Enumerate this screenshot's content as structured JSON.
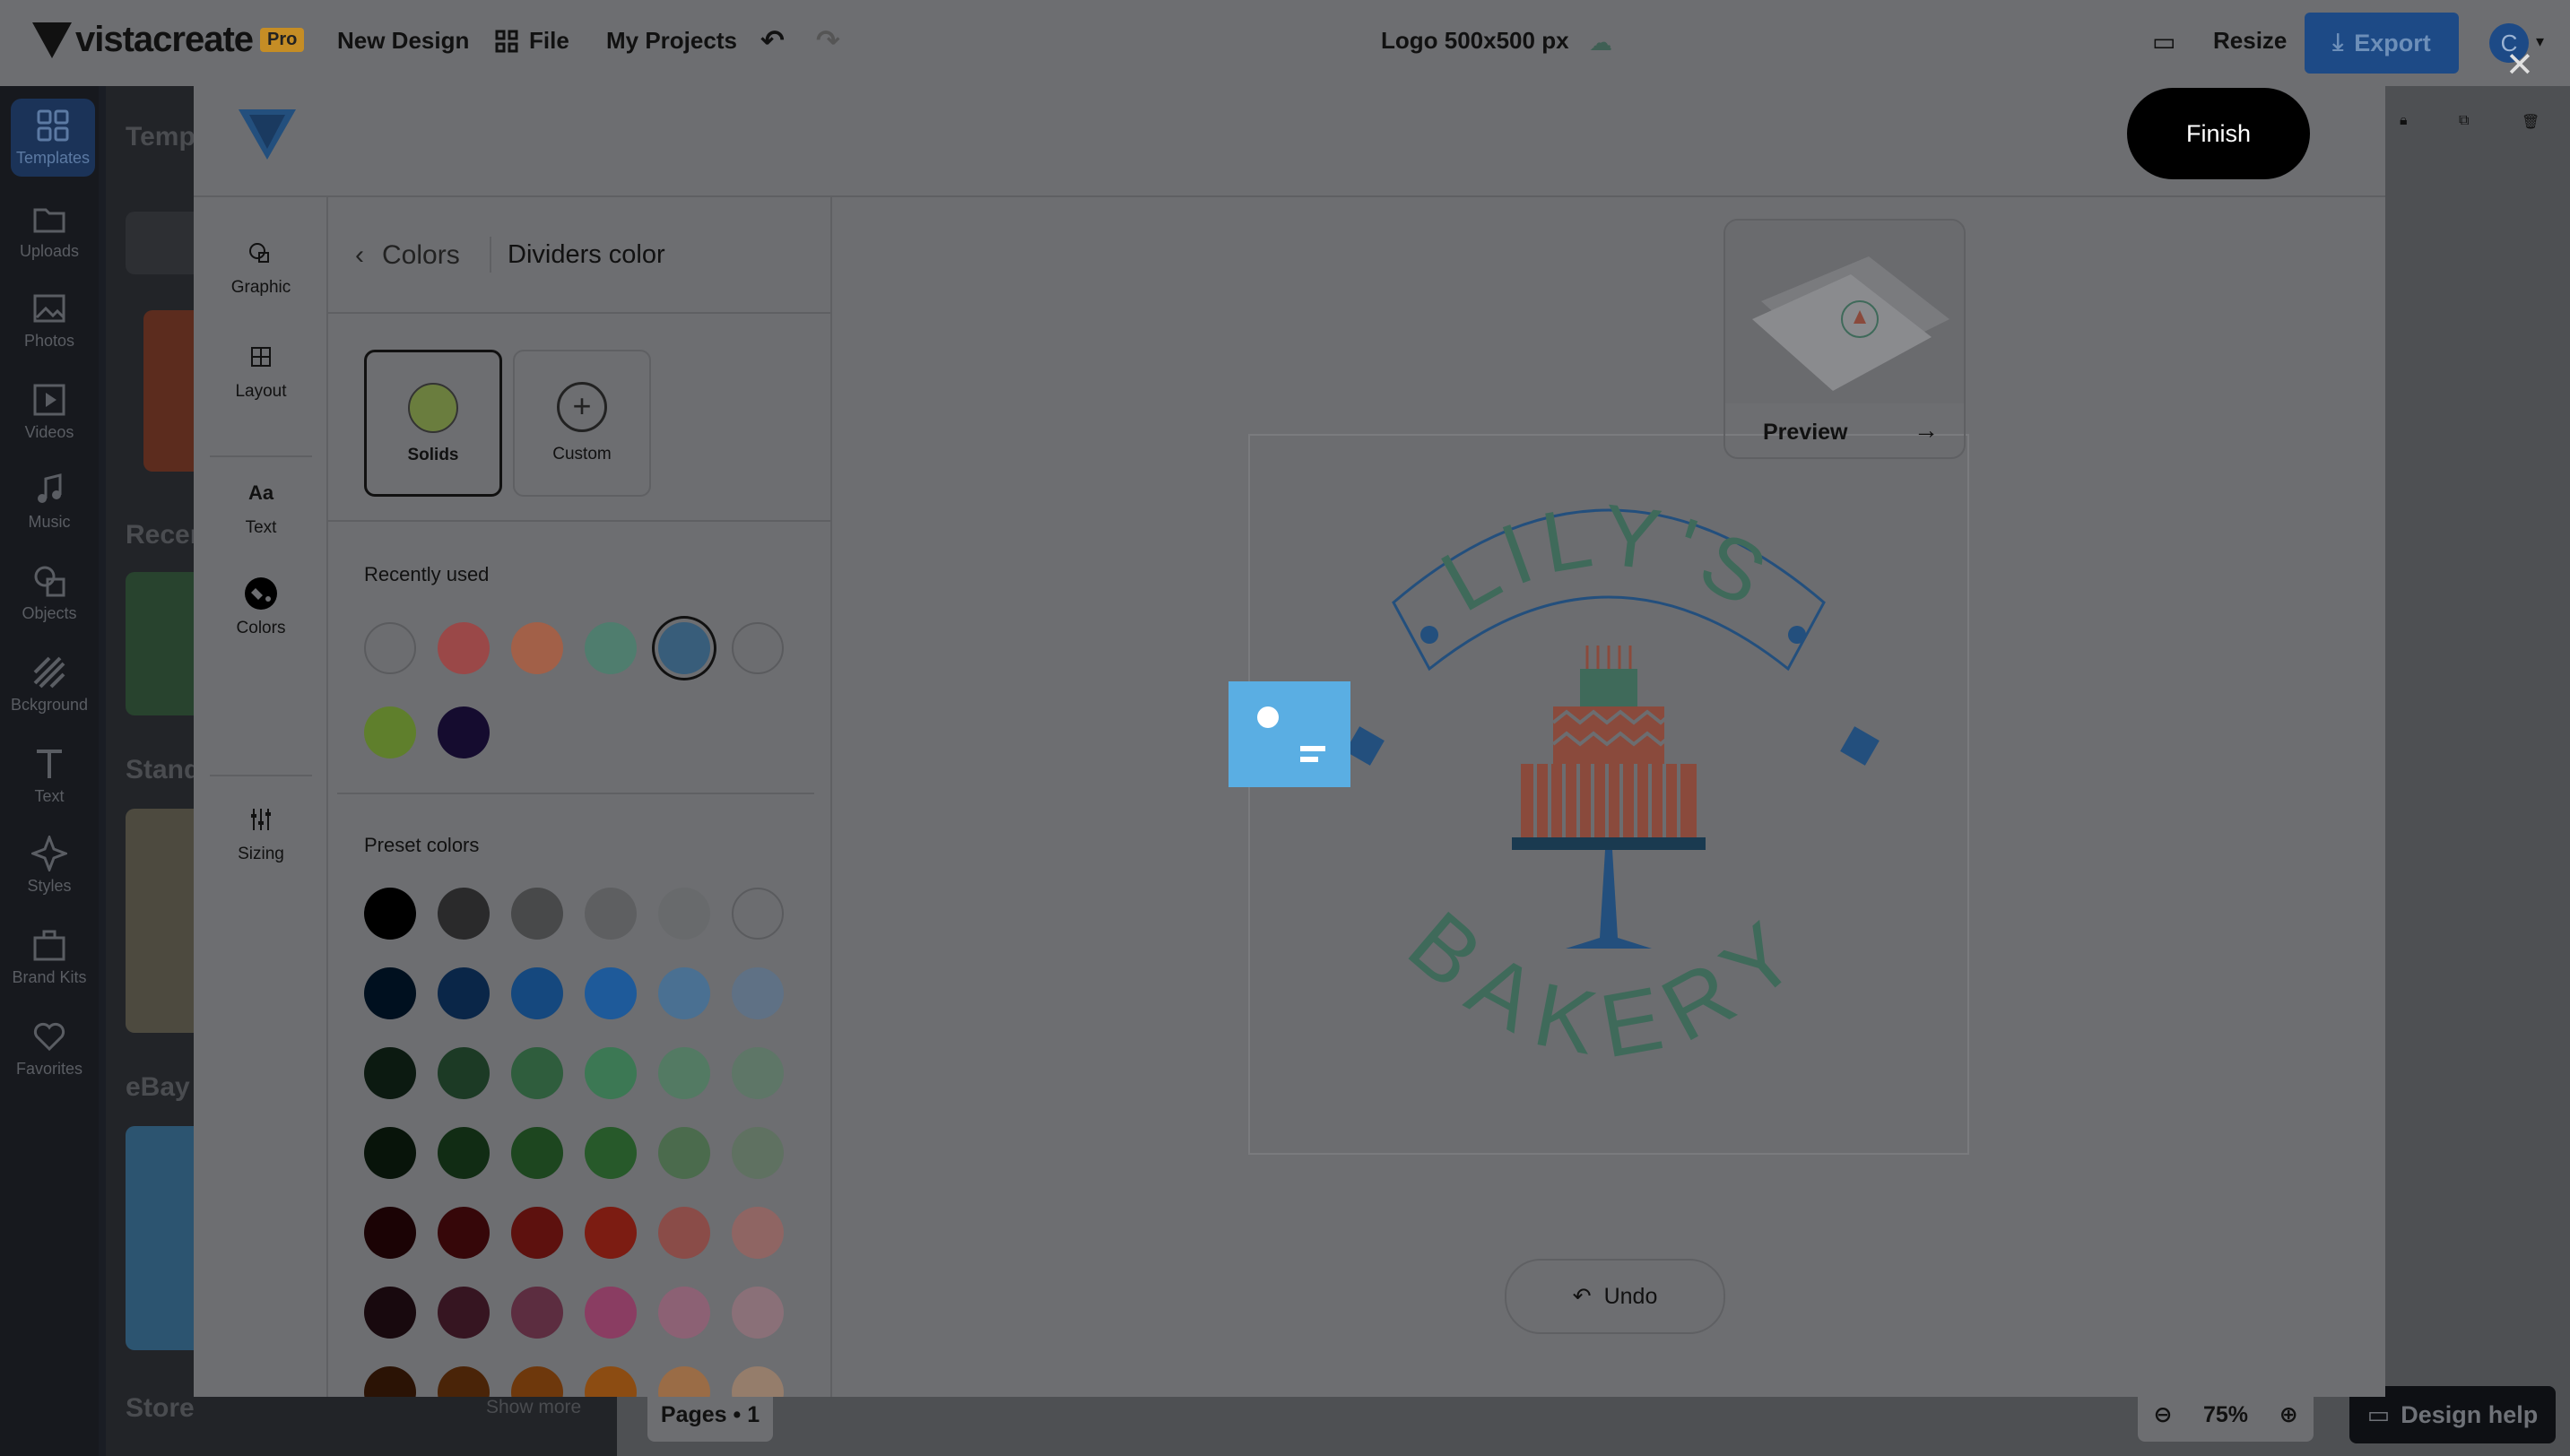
{
  "app": {
    "brand": "vistacreate",
    "pro_badge": "Pro",
    "menu": {
      "new_design": "New Design",
      "file": "File",
      "my_projects": "My Projects"
    },
    "doc_title": "Logo 500x500 px",
    "resize": "Resize",
    "export": "Export",
    "avatar_initial": "C"
  },
  "leftnav": {
    "items": [
      {
        "label": "Templates",
        "icon": "templates-icon"
      },
      {
        "label": "Uploads",
        "icon": "folder-icon"
      },
      {
        "label": "Photos",
        "icon": "image-icon"
      },
      {
        "label": "Videos",
        "icon": "video-icon"
      },
      {
        "label": "Music",
        "icon": "music-icon"
      },
      {
        "label": "Objects",
        "icon": "shapes-icon"
      },
      {
        "label": "Bckground",
        "icon": "background-icon"
      },
      {
        "label": "Text",
        "icon": "text-icon"
      },
      {
        "label": "Styles",
        "icon": "sparkle-icon"
      },
      {
        "label": "Brand Kits",
        "icon": "briefcase-icon"
      },
      {
        "label": "Favorites",
        "icon": "heart-icon"
      }
    ]
  },
  "leftpanel": {
    "title": "Temp",
    "sections": [
      "Recen",
      "Stand",
      "eBay",
      "Store"
    ],
    "show_more": "Show more"
  },
  "footer": {
    "pages": "Pages • 1",
    "zoom": "75%",
    "design_help": "Design help"
  },
  "modal": {
    "finish": "Finish",
    "tools": [
      {
        "label": "Graphic",
        "icon": "graphic-icon"
      },
      {
        "label": "Layout",
        "icon": "layout-icon"
      },
      {
        "label": "Text",
        "icon": "text-aa-icon"
      },
      {
        "label": "Colors",
        "icon": "paint-bucket-icon"
      },
      {
        "label": "Sizing",
        "icon": "sliders-icon"
      }
    ],
    "colors_panel": {
      "back_label": "Colors",
      "title": "Dividers color",
      "tabs": {
        "solids": "Solids",
        "custom": "Custom"
      },
      "recently_used_label": "Recently used",
      "recently_used": [
        "#6c6d70",
        "#9a4848",
        "#a26048",
        "#4f7d6e",
        "#385d7a",
        "#6c6d70",
        "#5f7f2c",
        "#150c2f"
      ],
      "selected_recent_index": 4,
      "preset_label": "Preset colors",
      "preset_rows": [
        [
          "#000000",
          "#2a2a2b",
          "#48494a",
          "#5e5f61",
          "#686a6c",
          "#6c6d70"
        ],
        [
          "#00101f",
          "#0a2648",
          "#15487e",
          "#1e5a9a",
          "#4a7092",
          "#5f7185"
        ],
        [
          "#0c1a11",
          "#1c3a25",
          "#2f5d3d",
          "#3c7854",
          "#537a63",
          "#5e7667"
        ],
        [
          "#08140a",
          "#112c14",
          "#1d461f",
          "#27592a",
          "#4b6b4d",
          "#5f7161"
        ],
        [
          "#1b0305",
          "#360709",
          "#5d110e",
          "#7c1c12",
          "#8a4c48",
          "#8f6563"
        ],
        [
          "#18090e",
          "#361521",
          "#5c2d40",
          "#8a3d62",
          "#8c6174",
          "#8a7078"
        ],
        [
          "#2b1305",
          "#4a2408",
          "#6e380c",
          "#8c4c12",
          "#9a6c46",
          "#957d6b"
        ]
      ]
    },
    "preview_label": "Preview",
    "undo_label": "Undo",
    "design_text": {
      "top": "LILY'S",
      "bottom": "BAKERY"
    }
  },
  "colors": {
    "accent": "#1d4a86",
    "finish_bg": "#000000",
    "drag_marker": "#5aaee3"
  }
}
